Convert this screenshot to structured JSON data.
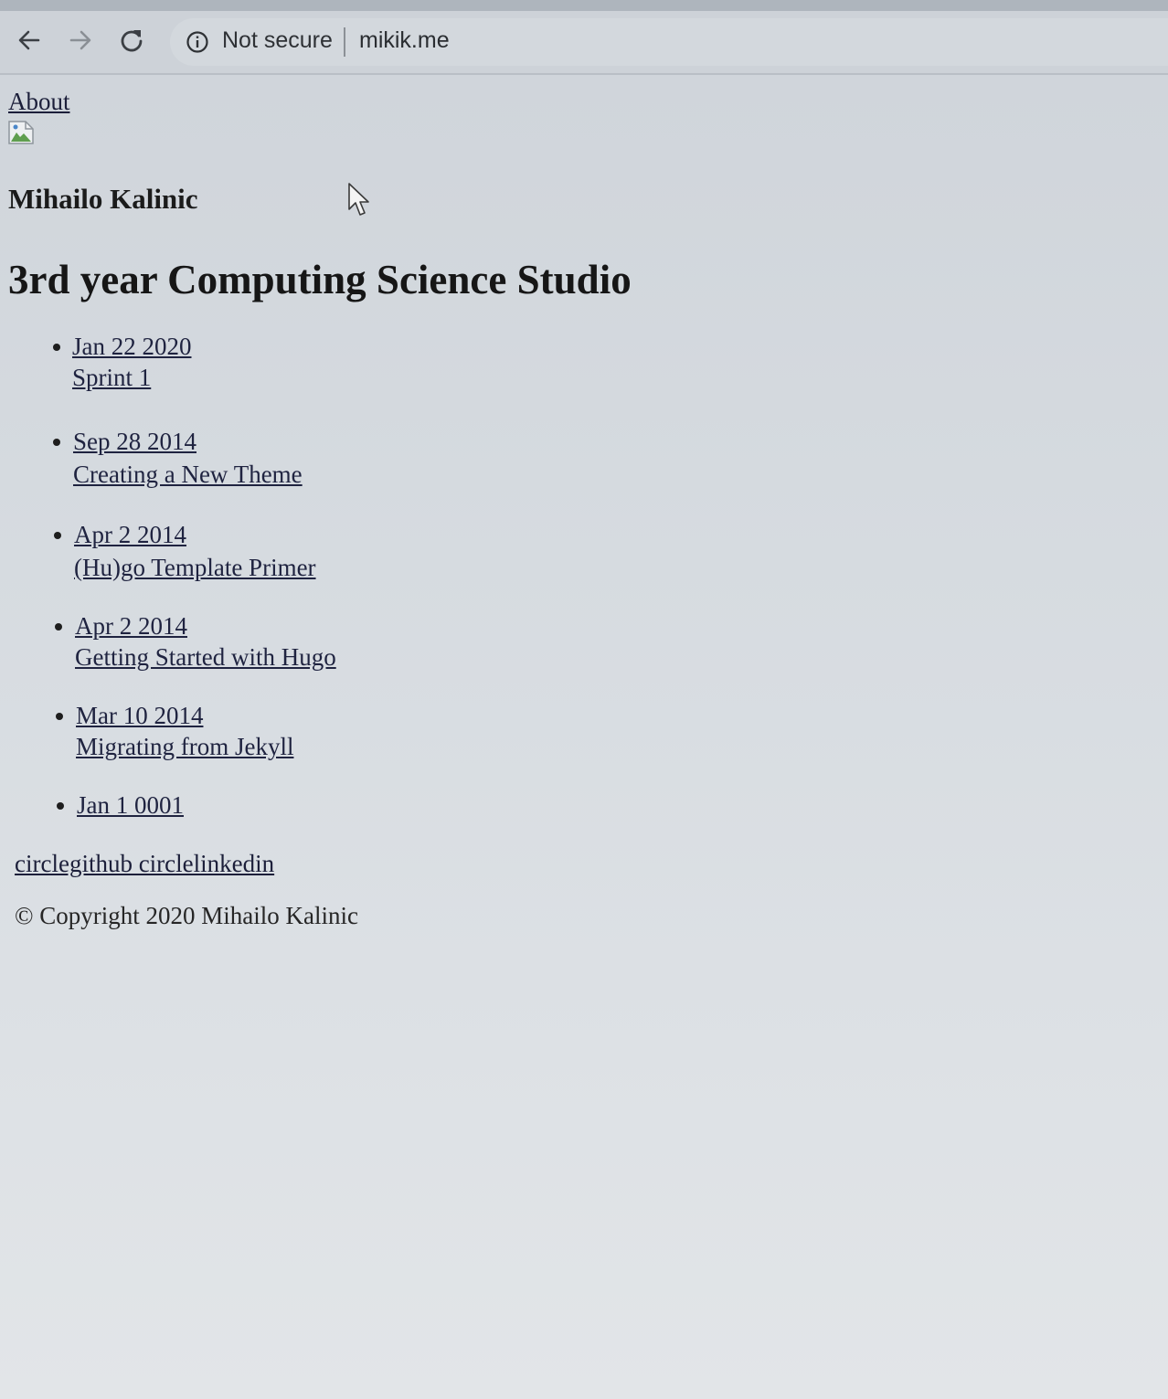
{
  "browser": {
    "security_label": "Not secure",
    "url": "mikik.me",
    "icons": [
      "back-arrow-icon",
      "forward-arrow-icon",
      "reload-icon",
      "info-icon"
    ]
  },
  "page": {
    "about_label": "About",
    "author_name": "Mihailo Kalinic",
    "section_title": "3rd year Computing Science Studio",
    "posts": [
      {
        "date": "Jan 22 2020",
        "title": "Sprint 1"
      },
      {
        "date": "Sep 28 2014",
        "title": "Creating a New Theme"
      },
      {
        "date": "Apr 2 2014",
        "title": "(Hu)go Template Primer"
      },
      {
        "date": "Apr 2 2014",
        "title": "Getting Started with Hugo"
      },
      {
        "date": "Mar 10 2014",
        "title": "Migrating from Jekyll"
      },
      {
        "date": "Jan 1 0001",
        "title": ""
      }
    ],
    "social_label": "circlegithub circlelinkedin",
    "copyright": "© Copyright 2020 Mihailo Kalinic"
  }
}
